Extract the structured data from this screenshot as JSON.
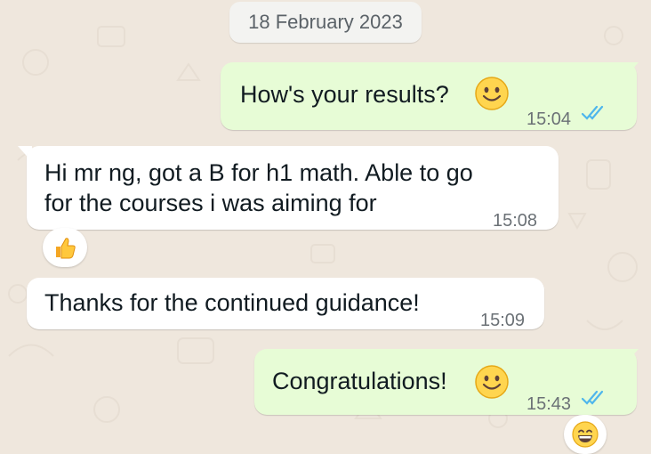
{
  "chat": {
    "date_separator": "18 February 2023",
    "messages": [
      {
        "direction": "outgoing",
        "text": "How's your results?",
        "emoji": "slightly-smiling-face",
        "time": "15:04",
        "status": "read"
      },
      {
        "direction": "incoming",
        "text_line1": "Hi mr ng, got a B for h1 math. Able to go",
        "text_line2": "for the courses i was aiming for",
        "time": "15:08",
        "reaction": "thumbs-up"
      },
      {
        "direction": "incoming",
        "text": "Thanks for the continued guidance!",
        "time": "15:09"
      },
      {
        "direction": "outgoing",
        "text": "Congratulations!",
        "emoji": "slightly-smiling-face",
        "time": "15:43",
        "status": "read",
        "reaction": "grinning-face-with-smiling-eyes"
      }
    ]
  },
  "colors": {
    "background": "#efe7dd",
    "outgoing_bubble": "#e7fcd6",
    "incoming_bubble": "#ffffff",
    "read_ticks": "#4fb6ec",
    "timestamp": "#6b7176"
  }
}
